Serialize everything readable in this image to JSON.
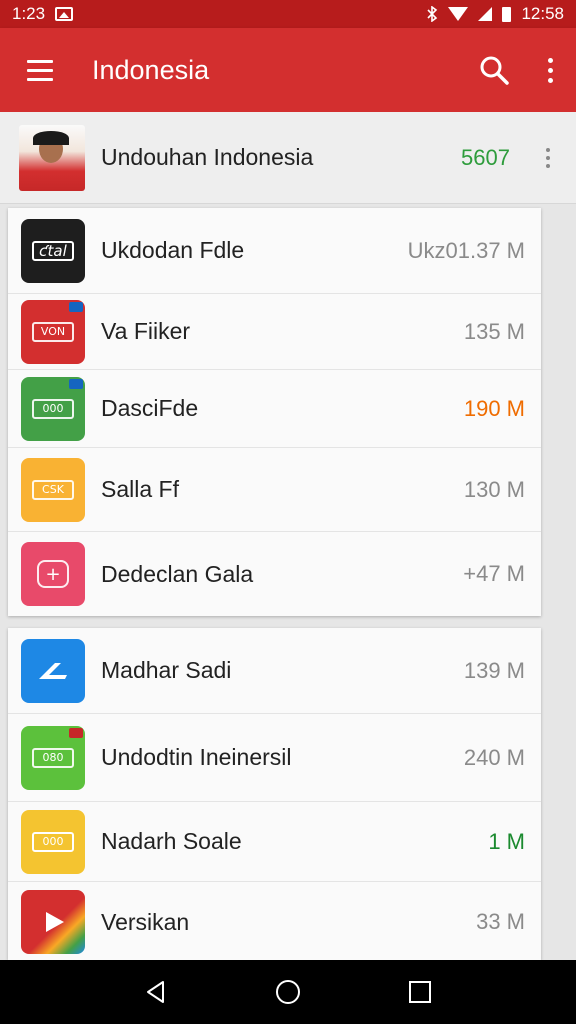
{
  "status": {
    "time": "1:23",
    "clock": "12:58",
    "icons": [
      "image-icon",
      "bluetooth-icon",
      "wifi-icon",
      "signal-icon",
      "battery-icon"
    ]
  },
  "appbar": {
    "title": "Indonesia",
    "color": "#d32f2f"
  },
  "header": {
    "name": "Undouhan Indonesia",
    "count": "5607"
  },
  "card1": [
    {
      "name": "Ukdodan Fdle",
      "size": "Ukz01.37 M",
      "icon": "play-film-icon",
      "color": "#1e1e1e",
      "glyph": "ƈtal"
    },
    {
      "name": "Va Fiiker",
      "size": "135 M",
      "icon": "ticket-icon",
      "color": "#d32f2f",
      "glyph": "VON"
    },
    {
      "name": "DasciFde",
      "size": "190 M",
      "icon": "ticket-icon",
      "color": "#43a047",
      "glyph": "000"
    },
    {
      "name": "Salla Ff",
      "size": "130 M",
      "icon": "ticket-icon",
      "color": "#f9b233",
      "glyph": "CSK"
    },
    {
      "name": "Dedeclan Gala",
      "size": "+47 M",
      "icon": "gift-icon",
      "color": "#e84a6a",
      "glyph": "+"
    }
  ],
  "card2": [
    {
      "name": "Madhar Sadi",
      "size": "139 M",
      "icon": "flight-icon",
      "color": "#1e88e5",
      "glyph": ""
    },
    {
      "name": "Undodtin Ineinersil",
      "size": "240 M",
      "icon": "ticket-icon",
      "color": "#5cc13c",
      "glyph": "080"
    },
    {
      "name": "Nadarh Soale",
      "size": "1 M",
      "icon": "ticket-icon",
      "color": "#f4c430",
      "glyph": "000"
    },
    {
      "name": "Versikan",
      "size": "33 M",
      "icon": "video-play-icon",
      "color": "#d32f2f",
      "glyph": ""
    }
  ]
}
